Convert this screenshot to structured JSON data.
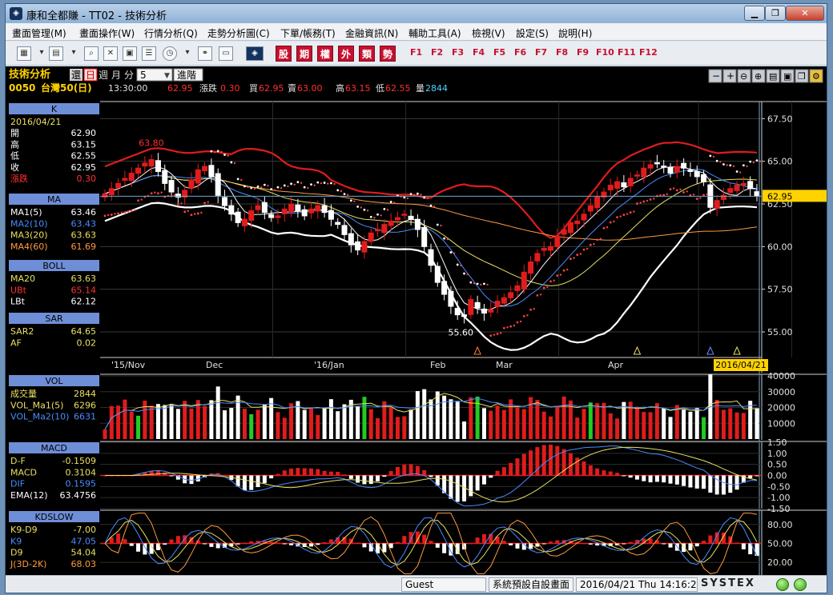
{
  "window": {
    "title": "康和全都賺 - TT02 - 技術分析",
    "min": "▁",
    "max": "❐",
    "close": "✕"
  },
  "menu": [
    "畫面管理(M)",
    "畫面操作(W)",
    "行情分析(Q)",
    "走勢分析圖(C)",
    "下單/帳務(T)",
    "金融資訊(N)",
    "輔助工具(A)",
    "檢視(V)",
    "設定(S)",
    "說明(H)"
  ],
  "toolbar": {
    "cn_buttons": [
      "股",
      "期",
      "權",
      "外",
      "類",
      "勢"
    ],
    "f_keys": [
      "F1",
      "F2",
      "F3",
      "F4",
      "F5",
      "F6",
      "F7",
      "F8",
      "F9",
      "F10",
      "F11",
      "F12"
    ]
  },
  "header": {
    "label": "技術分析",
    "restore": "還",
    "tabs": [
      "日",
      "週",
      "月",
      "分"
    ],
    "period": "5",
    "advanced": "進階",
    "code": "0050",
    "name": "台灣50(日)",
    "time": "13:30:00",
    "last": "62.95",
    "change_label": "漲跌",
    "change": "0.30",
    "bid_label": "買",
    "bid": "62.95",
    "ask_label": "賣",
    "ask": "63.00",
    "high_label": "高",
    "high": "63.15",
    "low_label": "低",
    "low": "62.55",
    "vol_label": "量",
    "vol": "2844"
  },
  "panels": {
    "k": {
      "title": "K",
      "date": "2016/04/21",
      "rows": [
        {
          "label": "開",
          "value": "62.90",
          "color": "#ffffff"
        },
        {
          "label": "高",
          "value": "63.15",
          "color": "#ffffff"
        },
        {
          "label": "低",
          "value": "62.55",
          "color": "#ffffff"
        },
        {
          "label": "收",
          "value": "62.95",
          "color": "#ffffff"
        },
        {
          "label": "漲跌",
          "value": "0.30",
          "color": "#ff3030"
        }
      ]
    },
    "ma": {
      "title": "MA",
      "rows": [
        {
          "label": "MA1(5)",
          "value": "63.46",
          "color": "#ffffff"
        },
        {
          "label": "MA2(10)",
          "value": "63.43",
          "color": "#4a8cff"
        },
        {
          "label": "MA3(20)",
          "value": "63.63",
          "color": "#e8e060"
        },
        {
          "label": "MA4(60)",
          "value": "61.69",
          "color": "#ff9a40"
        }
      ]
    },
    "boll": {
      "title": "BOLL",
      "rows": [
        {
          "label": "MA20",
          "value": "63.63",
          "color": "#e8e060"
        },
        {
          "label": "UBt",
          "value": "65.14",
          "color": "#ff3030"
        },
        {
          "label": "LBt",
          "value": "62.12",
          "color": "#ffffff"
        }
      ]
    },
    "sar": {
      "title": "SAR",
      "rows": [
        {
          "label": "SAR2",
          "value": "64.65",
          "color": "#e8e060"
        },
        {
          "label": "AF",
          "value": "0.02",
          "color": "#e8e060"
        }
      ]
    },
    "vol": {
      "title": "VOL",
      "rows": [
        {
          "label": "成交量",
          "value": "2844",
          "color": "#e8e060"
        },
        {
          "label": "VOL_Ma1(5)",
          "value": "6296",
          "color": "#e8e060"
        },
        {
          "label": "VOL_Ma2(10)",
          "value": "6631",
          "color": "#4a8cff"
        }
      ]
    },
    "macd": {
      "title": "MACD",
      "rows": [
        {
          "label": "D-F",
          "value": "-0.1509",
          "color": "#e8e060"
        },
        {
          "label": "MACD",
          "value": "0.3104",
          "color": "#e8e060"
        },
        {
          "label": "DIF",
          "value": "0.1595",
          "color": "#4a8cff"
        },
        {
          "label": "EMA(12)",
          "value": "63.4756",
          "color": "#ffffff"
        }
      ]
    },
    "kd": {
      "title": "KDSLOW",
      "rows": [
        {
          "label": "K9-D9",
          "value": "-7.00",
          "color": "#e8e060"
        },
        {
          "label": "K9",
          "value": "47.05",
          "color": "#4a8cff"
        },
        {
          "label": "D9",
          "value": "54.04",
          "color": "#e8e060"
        },
        {
          "label": "J(3D-2K)",
          "value": "68.03",
          "color": "#ff9a40"
        }
      ]
    }
  },
  "price_axis": {
    "ticks": [
      "67.50",
      "65.00",
      "62.50",
      "60.00",
      "57.50",
      "55.00"
    ],
    "current": "62.95"
  },
  "vol_axis": {
    "ticks": [
      "40000",
      "30000",
      "20000",
      "10000"
    ]
  },
  "macd_axis": {
    "ticks": [
      "1.50",
      "1.00",
      "0.50",
      "0.00",
      "-0.50",
      "-1.00",
      "-1.50"
    ]
  },
  "kd_axis": {
    "ticks": [
      "80.00",
      "50.00",
      "20.00"
    ]
  },
  "date_axis": {
    "labels": [
      "'15/Nov",
      "Dec",
      "'16/Jan",
      "Feb",
      "Mar",
      "Apr"
    ],
    "current": "2016/04/21"
  },
  "annotations": {
    "high": "63.80",
    "low": "55.60"
  },
  "status": {
    "user": "Guest",
    "layout": "系統預設自設畫面",
    "datetime": "2016/04/21 Thu 14:16:29",
    "vendor": "SYSTEX"
  },
  "colors": {
    "up": "#e11c1c",
    "down": "#ffffff",
    "bg": "#000000",
    "panel_title": "#6f8ed8"
  },
  "chart_data": {
    "type": "candlestick",
    "title": "",
    "x_labels": [
      "'15/Nov",
      "Dec",
      "'16/Jan",
      "Feb",
      "Mar",
      "Apr"
    ],
    "ylim": [
      53.5,
      68.5
    ],
    "close": [
      63.1,
      63.4,
      63.7,
      64.0,
      64.3,
      64.6,
      64.9,
      65.1,
      64.4,
      63.7,
      63.2,
      62.9,
      63.3,
      63.9,
      64.5,
      64.7,
      64.1,
      63.0,
      62.4,
      61.9,
      61.4,
      61.6,
      62.1,
      62.4,
      62.0,
      61.7,
      61.8,
      62.2,
      62.5,
      62.1,
      61.8,
      62.2,
      62.4,
      62.0,
      61.6,
      61.3,
      60.7,
      60.1,
      59.8,
      60.3,
      60.8,
      61.0,
      61.3,
      61.5,
      61.7,
      61.9,
      61.6,
      61.0,
      60.0,
      58.9,
      57.9,
      57.2,
      56.5,
      56.0,
      55.9,
      56.9,
      56.4,
      56.1,
      56.3,
      56.8,
      57.0,
      57.3,
      57.7,
      58.5,
      59.1,
      59.6,
      59.9,
      60.0,
      60.6,
      61.0,
      61.4,
      61.5,
      61.9,
      62.4,
      62.9,
      63.2,
      63.6,
      63.8,
      63.5,
      64.0,
      64.2,
      64.6,
      64.8,
      64.9,
      64.7,
      64.3,
      64.7,
      64.6,
      64.4,
      64.1,
      63.8,
      62.3,
      62.7,
      63.0,
      63.4,
      63.6,
      63.7,
      63.4,
      62.95
    ],
    "volume_range": [
      0,
      40000
    ],
    "macd_range": [
      -1.5,
      1.5
    ],
    "kd_range": [
      0,
      100
    ]
  }
}
